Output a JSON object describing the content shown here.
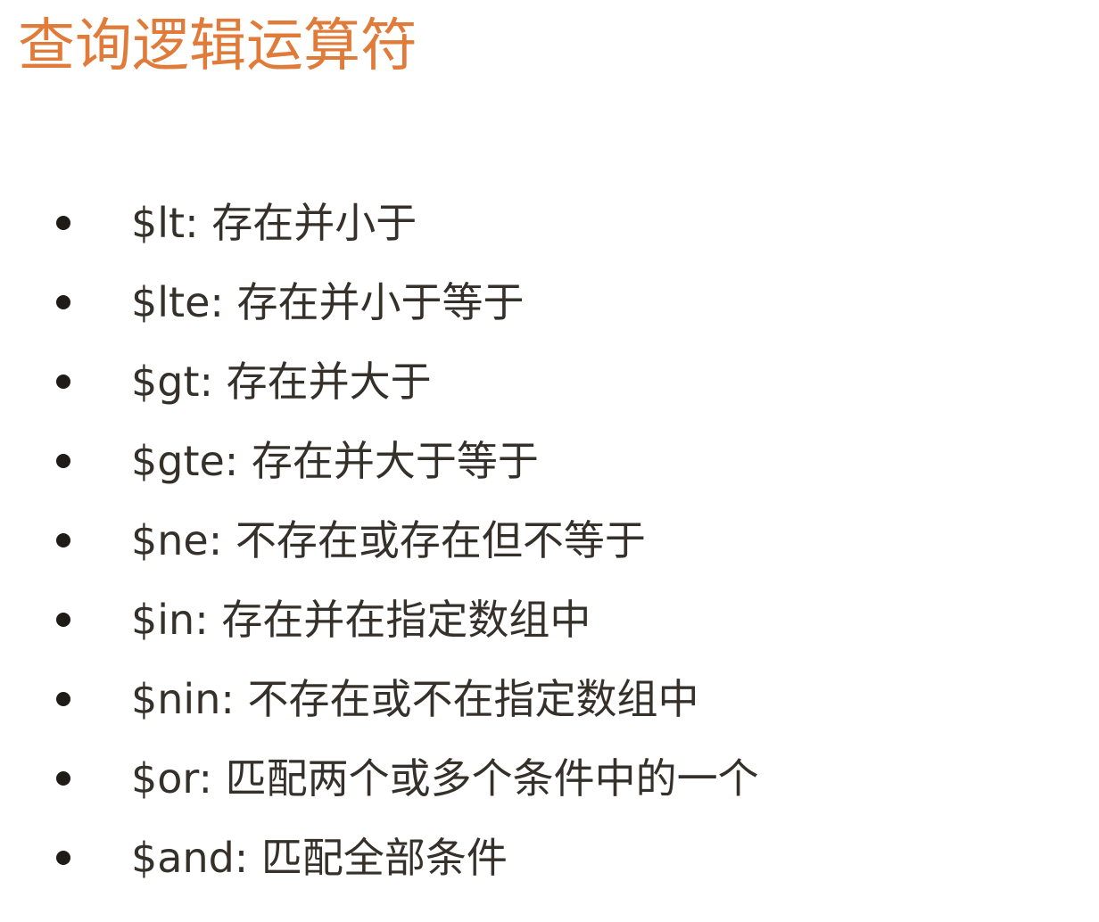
{
  "colors": {
    "title": "#e07b39",
    "text": "#36302a",
    "bullet": "#1f1b17",
    "background": "#ffffff"
  },
  "title": "查询逻辑运算符",
  "items": [
    {
      "text": "$lt: 存在并小于"
    },
    {
      "text": "$lte: 存在并小于等于"
    },
    {
      "text": "$gt: 存在并大于"
    },
    {
      "text": "$gte: 存在并大于等于"
    },
    {
      "text": "$ne: 不存在或存在但不等于"
    },
    {
      "text": "$in: 存在并在指定数组中"
    },
    {
      "text": "$nin: 不存在或不在指定数组中"
    },
    {
      "text": "$or: 匹配两个或多个条件中的一个"
    },
    {
      "text": "$and: 匹配全部条件"
    }
  ]
}
